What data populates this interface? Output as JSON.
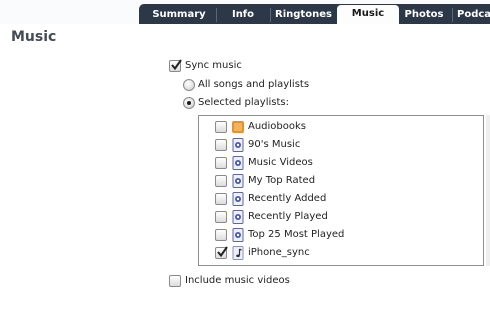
{
  "tabs": [
    {
      "label": "Summary",
      "selected": false
    },
    {
      "label": "Info",
      "selected": false
    },
    {
      "label": "Ringtones",
      "selected": false
    },
    {
      "label": "Music",
      "selected": true
    },
    {
      "label": "Photos",
      "selected": false
    },
    {
      "label": "Podca",
      "selected": false
    }
  ],
  "page": {
    "title": "Music"
  },
  "sync": {
    "label": "Sync music",
    "checked": true
  },
  "options": [
    {
      "label": "All songs and playlists",
      "selected": false
    },
    {
      "label": "Selected playlists:",
      "selected": true
    }
  ],
  "playlists": [
    {
      "name": "Audiobooks",
      "icon": "audiobooks-icon",
      "checked": false
    },
    {
      "name": "90's Music",
      "icon": "smart-playlist-icon",
      "checked": false
    },
    {
      "name": "Music Videos",
      "icon": "smart-playlist-icon",
      "checked": false
    },
    {
      "name": "My Top Rated",
      "icon": "smart-playlist-icon",
      "checked": false
    },
    {
      "name": "Recently Added",
      "icon": "smart-playlist-icon",
      "checked": false
    },
    {
      "name": "Recently Played",
      "icon": "smart-playlist-icon",
      "checked": false
    },
    {
      "name": "Top 25 Most Played",
      "icon": "smart-playlist-icon",
      "checked": false
    },
    {
      "name": "iPhone_sync",
      "icon": "music-note-icon",
      "checked": true
    }
  ],
  "include_videos": {
    "label": "Include music videos",
    "checked": false
  },
  "colors": {
    "tab_bar": "#2c3848",
    "title": "#444c56",
    "smart_icon": "#4a5aa8",
    "audiobook_icon": "#e8902a"
  }
}
